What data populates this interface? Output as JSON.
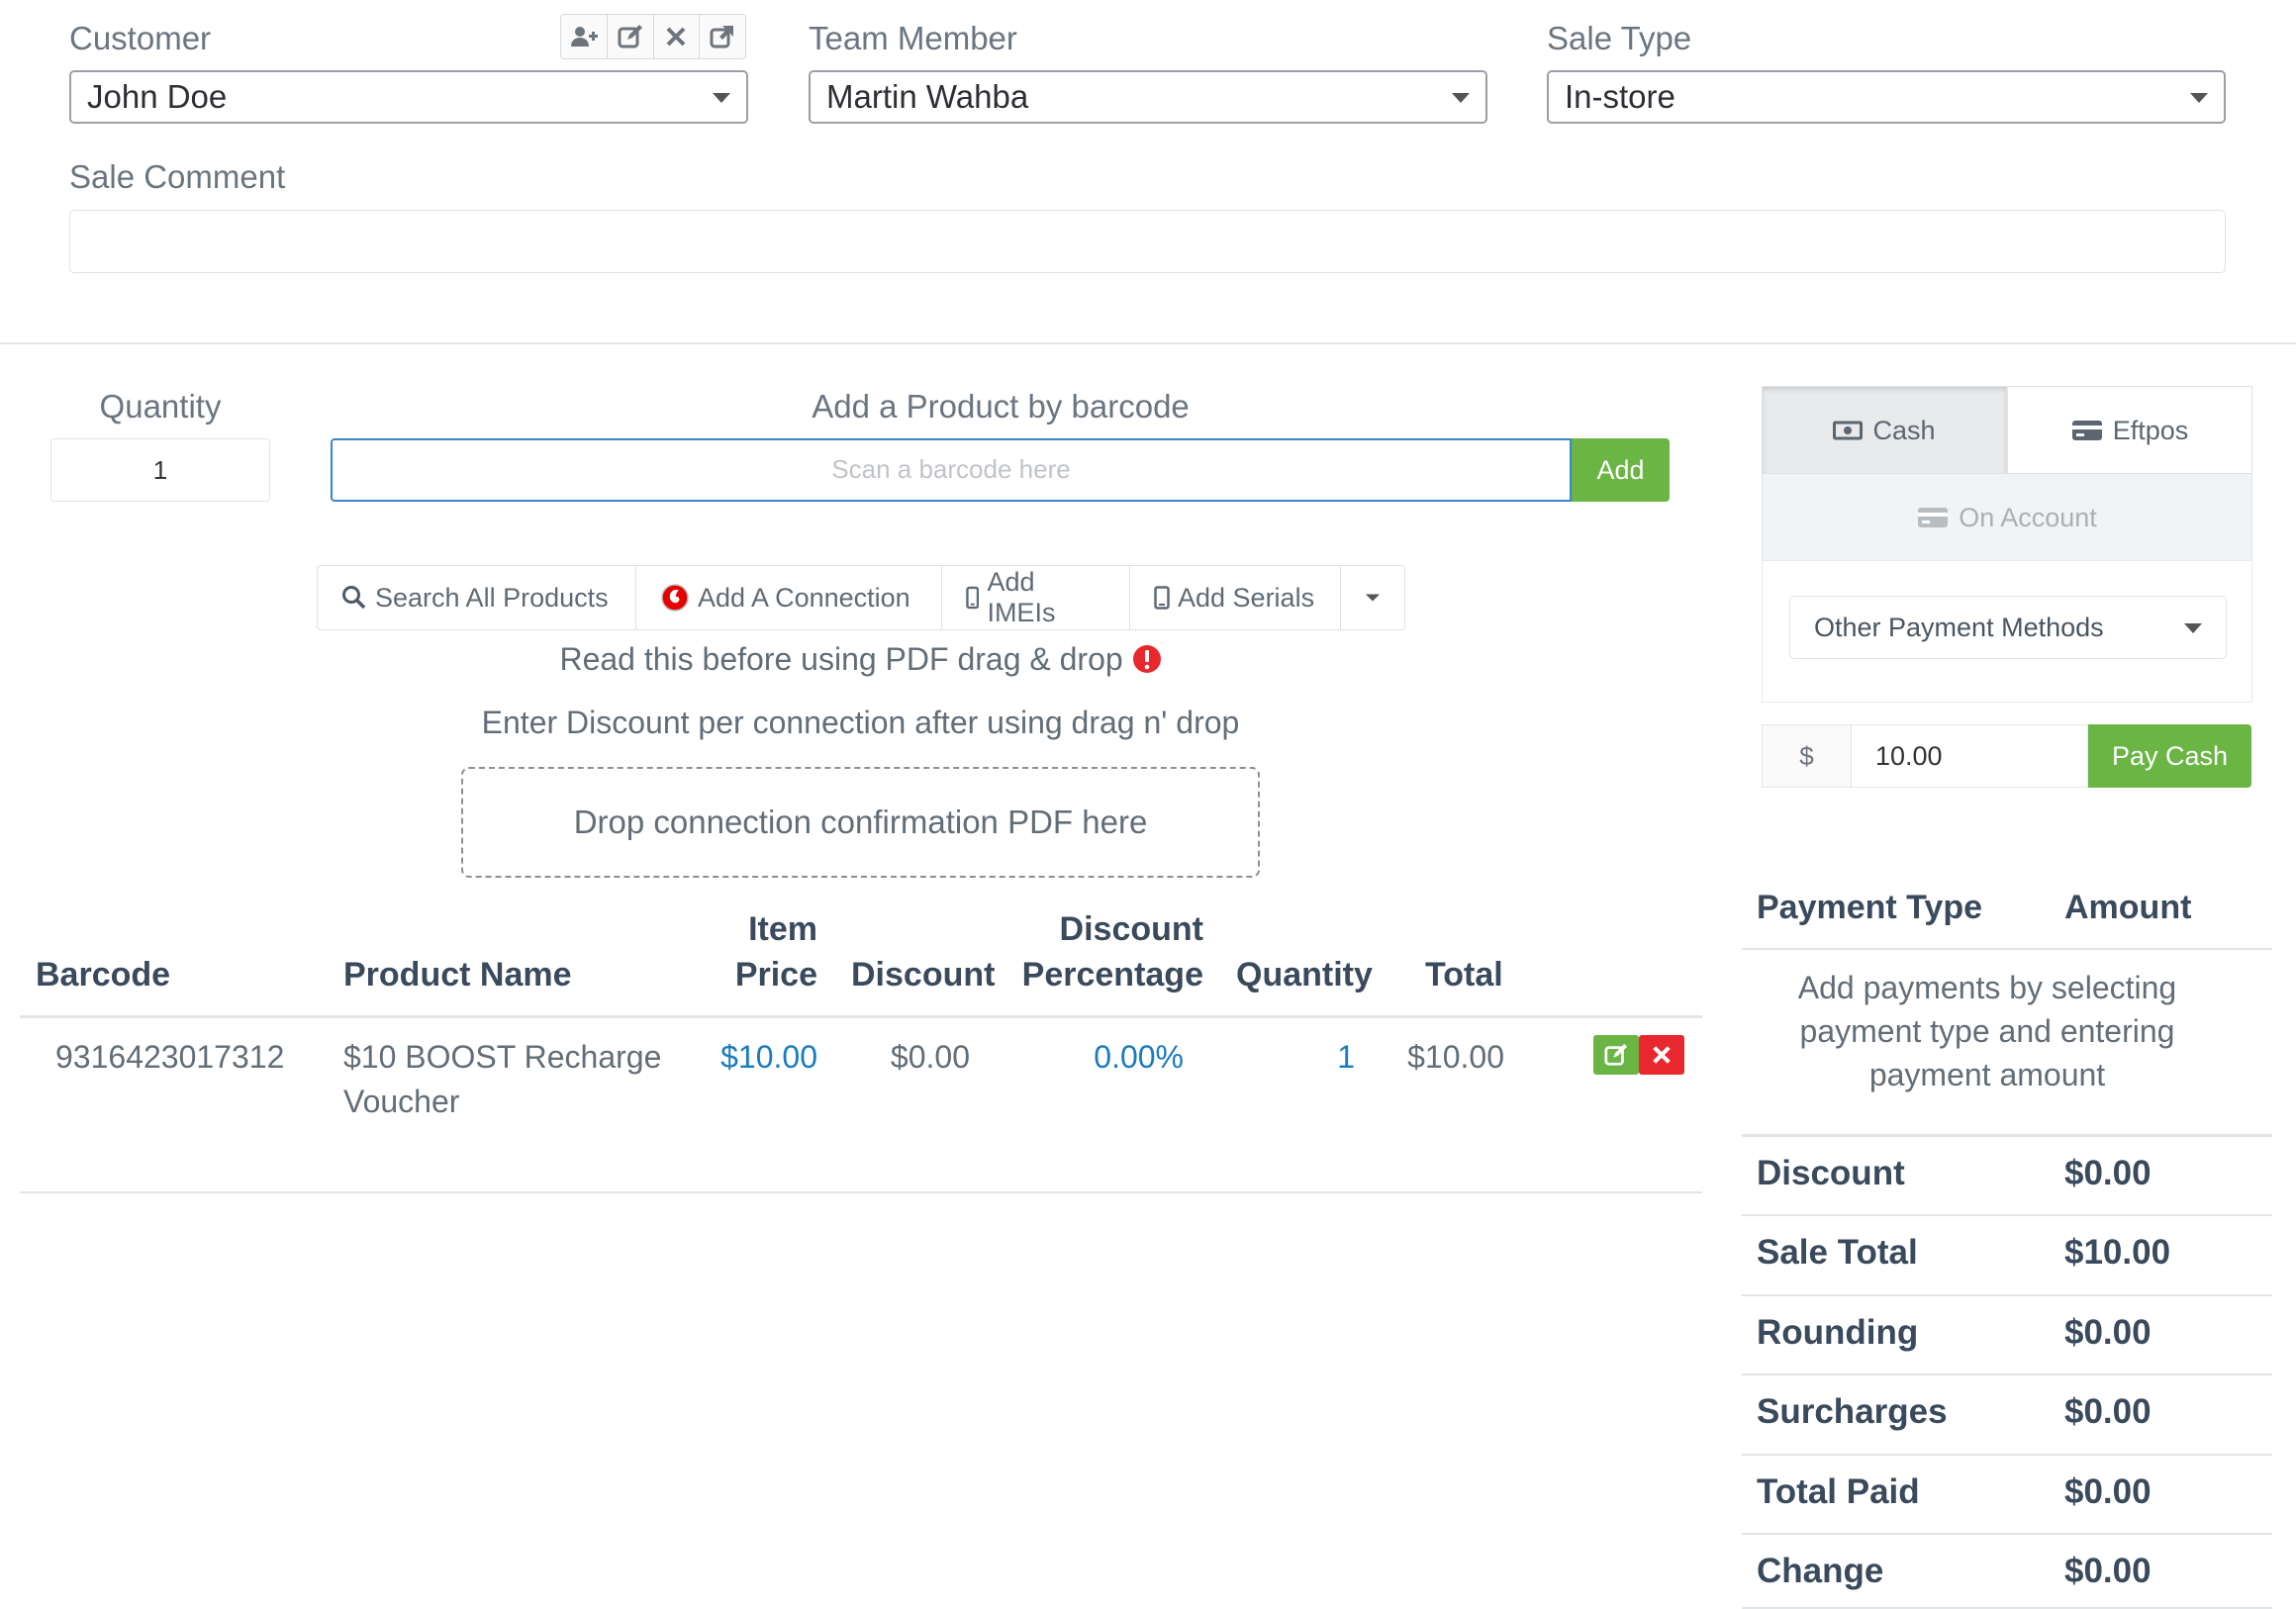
{
  "form": {
    "customer_label": "Customer",
    "customer_value": "John Doe",
    "team_label": "Team Member",
    "team_value": "Martin Wahba",
    "saletype_label": "Sale Type",
    "saletype_value": "In-store",
    "comment_label": "Sale Comment",
    "comment_value": ""
  },
  "entry": {
    "quantity_label": "Quantity",
    "quantity_value": "1",
    "barcode_label": "Add a Product by barcode",
    "barcode_placeholder": "Scan a barcode here",
    "add_label": "Add"
  },
  "toolbar": {
    "search_label": "Search All Products",
    "connection_label": "Add A Connection",
    "imeis_label": "Add IMEIs",
    "serials_label": "Add Serials"
  },
  "notes": {
    "pdf_warning": "Read this before using PDF drag & drop",
    "discount_note": "Enter Discount per connection after using drag n' drop",
    "dropzone": "Drop connection confirmation PDF here"
  },
  "table": {
    "headers": {
      "barcode": "Barcode",
      "product": "Product Name",
      "item": "Item",
      "price": "Price",
      "discount": "Discount",
      "discount2": "Discount",
      "percentage": "Percentage",
      "quantity": "Quantity",
      "total": "Total"
    },
    "rows": [
      {
        "barcode": "9316423017312",
        "name_line1": "$10 BOOST Recharge",
        "name_line2": "Voucher",
        "price": "$10.00",
        "discount": "$0.00",
        "discount_pct": "0.00%",
        "quantity": "1",
        "total": "$10.00"
      }
    ]
  },
  "payment": {
    "tabs": {
      "cash": "Cash",
      "eftpos": "Eftpos",
      "account": "On Account"
    },
    "other_methods": "Other Payment Methods",
    "currency": "$",
    "amount": "10.00",
    "pay_button": "Pay Cash",
    "col_type": "Payment Type",
    "col_amount": "Amount",
    "empty_msg_1": "Add payments by selecting",
    "empty_msg_2": "payment type and entering",
    "empty_msg_3": "payment amount"
  },
  "summary": [
    {
      "label": "Discount",
      "value": "$0.00"
    },
    {
      "label": "Sale Total",
      "value": "$10.00"
    },
    {
      "label": "Rounding",
      "value": "$0.00"
    },
    {
      "label": "Surcharges",
      "value": "$0.00"
    },
    {
      "label": "Total Paid",
      "value": "$0.00"
    },
    {
      "label": "Change",
      "value": "$0.00"
    }
  ],
  "colors": {
    "accent_blue": "#1a7bbf",
    "success_green": "#6ab544",
    "danger_red": "#e8282e"
  }
}
